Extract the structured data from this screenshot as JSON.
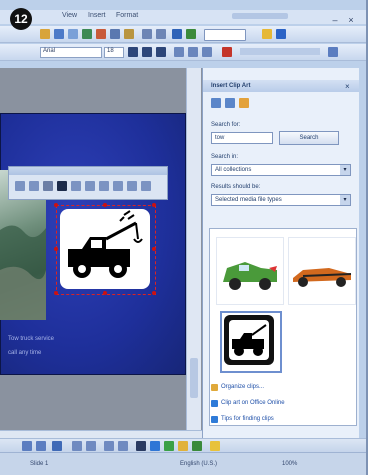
{
  "step_badge": "12",
  "menu": {
    "items": [
      "View",
      "Insert",
      "Format"
    ]
  },
  "toolbar": {
    "font_name": "Arial",
    "font_size": "18"
  },
  "task_pane": {
    "title": "Insert Clip Art",
    "search_label": "Search for:",
    "search_value": "tow",
    "go_button": "Search",
    "search_in_label": "Search in:",
    "search_in_value": "All collections",
    "results_label": "Results should be:",
    "results_value": "Selected media file types",
    "results": [
      {
        "name": "green truck clipart",
        "color": "#4a9a3a"
      },
      {
        "name": "race car clipart",
        "color": "#d2691e"
      },
      {
        "name": "tow truck clipart",
        "color": "#111111"
      }
    ],
    "links": [
      "Organize clips...",
      "Clip art on Office Online",
      "Tips for finding clips"
    ]
  },
  "slide": {
    "caption_lines": [
      "Tow truck service",
      "call any time"
    ]
  },
  "status": {
    "left": "Slide 1",
    "middle": "English (U.S.)",
    "right": "100%"
  },
  "colors": {
    "window_bg": "#bcd0ea",
    "slide_blue": "#1e2f9a",
    "selection": "#d22222"
  }
}
